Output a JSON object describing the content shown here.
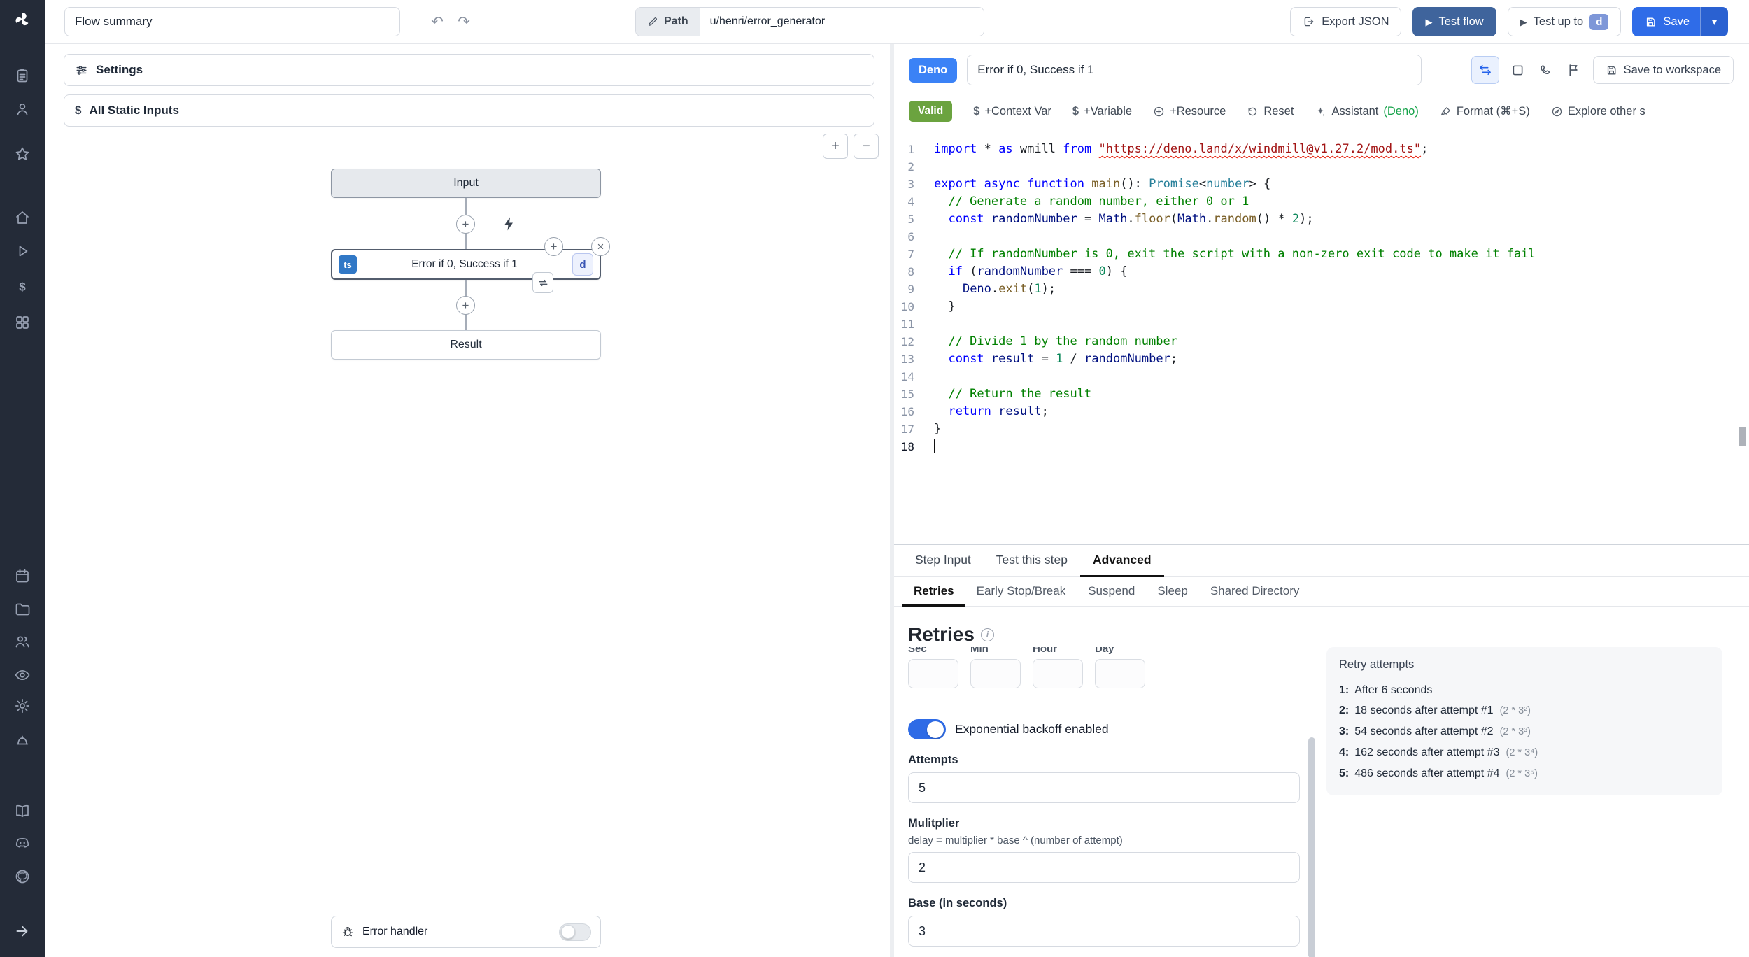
{
  "topbar": {
    "flow_summary": "Flow summary",
    "path_label": "Path",
    "path_value": "u/henri/error_generator",
    "export_json_label": "Export JSON",
    "test_flow_label": "Test flow",
    "test_up_to_label": "Test up to",
    "test_up_to_step": "d",
    "save_label": "Save"
  },
  "flow_panel": {
    "settings_label": "Settings",
    "static_inputs_label": "All Static Inputs",
    "zoom_in": "+",
    "zoom_out": "−",
    "input_node": "Input",
    "step_node": {
      "lang": "ts",
      "label": "Error if 0, Success if 1",
      "id": "d"
    },
    "result_node": "Result",
    "error_handler_label": "Error handler"
  },
  "editor": {
    "lang_badge": "Deno",
    "step_name": "Error if 0, Success if 1",
    "save_to_workspace_label": "Save to workspace",
    "toolbar": {
      "valid": "Valid",
      "context_var": "+Context Var",
      "variable": "+Variable",
      "resource": "+Resource",
      "reset": "Reset",
      "assistant": "Assistant",
      "assistant_lang": "(Deno)",
      "format": "Format (⌘+S)",
      "explore": "Explore other s"
    },
    "lines": [
      {
        "segs": [
          [
            "kw",
            "import"
          ],
          [
            "pl",
            " * "
          ],
          [
            "kw",
            "as"
          ],
          [
            "pl",
            " wmill "
          ],
          [
            "kw",
            "from"
          ],
          [
            "pl",
            " "
          ],
          [
            "stre",
            "\"https://deno.land/x/windmill@v1.27.2/mod.ts\""
          ],
          [
            "pl",
            ";"
          ]
        ]
      },
      {
        "segs": []
      },
      {
        "segs": [
          [
            "kw",
            "export"
          ],
          [
            "pl",
            " "
          ],
          [
            "kw",
            "async"
          ],
          [
            "pl",
            " "
          ],
          [
            "kw",
            "function"
          ],
          [
            "pl",
            " "
          ],
          [
            "fn",
            "main"
          ],
          [
            "pl",
            "(): "
          ],
          [
            "ty",
            "Promise"
          ],
          [
            "pl",
            "<"
          ],
          [
            "ty",
            "number"
          ],
          [
            "pl",
            "> {"
          ]
        ]
      },
      {
        "segs": [
          [
            "cm",
            "  // Generate a random number, either 0 or 1"
          ]
        ]
      },
      {
        "segs": [
          [
            "pl",
            "  "
          ],
          [
            "kw",
            "const"
          ],
          [
            "pl",
            " "
          ],
          [
            "vr",
            "randomNumber"
          ],
          [
            "pl",
            " = "
          ],
          [
            "vr",
            "Math"
          ],
          [
            "pl",
            "."
          ],
          [
            "fn",
            "floor"
          ],
          [
            "pl",
            "("
          ],
          [
            "vr",
            "Math"
          ],
          [
            "pl",
            "."
          ],
          [
            "fn",
            "random"
          ],
          [
            "pl",
            "() * "
          ],
          [
            "num",
            "2"
          ],
          [
            "pl",
            ");"
          ]
        ]
      },
      {
        "segs": []
      },
      {
        "segs": [
          [
            "cm",
            "  // If randomNumber is 0, exit the script with a non-zero exit code to make it fail"
          ]
        ]
      },
      {
        "segs": [
          [
            "pl",
            "  "
          ],
          [
            "kw",
            "if"
          ],
          [
            "pl",
            " ("
          ],
          [
            "vr",
            "randomNumber"
          ],
          [
            "pl",
            " === "
          ],
          [
            "num",
            "0"
          ],
          [
            "pl",
            ") {"
          ]
        ]
      },
      {
        "segs": [
          [
            "pl",
            "    "
          ],
          [
            "vr",
            "Deno"
          ],
          [
            "pl",
            "."
          ],
          [
            "fn",
            "exit"
          ],
          [
            "pl",
            "("
          ],
          [
            "num",
            "1"
          ],
          [
            "pl",
            ");"
          ]
        ]
      },
      {
        "segs": [
          [
            "pl",
            "  }"
          ]
        ]
      },
      {
        "segs": []
      },
      {
        "segs": [
          [
            "cm",
            "  // Divide 1 by the random number"
          ]
        ]
      },
      {
        "segs": [
          [
            "pl",
            "  "
          ],
          [
            "kw",
            "const"
          ],
          [
            "pl",
            " "
          ],
          [
            "vr",
            "result"
          ],
          [
            "pl",
            " = "
          ],
          [
            "num",
            "1"
          ],
          [
            "pl",
            " / "
          ],
          [
            "vr",
            "randomNumber"
          ],
          [
            "pl",
            ";"
          ]
        ]
      },
      {
        "segs": []
      },
      {
        "segs": [
          [
            "cm",
            "  // Return the result"
          ]
        ]
      },
      {
        "segs": [
          [
            "pl",
            "  "
          ],
          [
            "kw",
            "return"
          ],
          [
            "pl",
            " "
          ],
          [
            "vr",
            "result"
          ],
          [
            "pl",
            ";"
          ]
        ]
      },
      {
        "segs": [
          [
            "pl",
            "}"
          ]
        ]
      },
      {
        "segs": []
      }
    ]
  },
  "panel_tabs": {
    "step_input": "Step Input",
    "test_this_step": "Test this step",
    "advanced": "Advanced"
  },
  "advanced_tabs": {
    "retries": "Retries",
    "early_stop": "Early Stop/Break",
    "suspend": "Suspend",
    "sleep": "Sleep",
    "shared_directory": "Shared Directory"
  },
  "retries": {
    "title": "Retries",
    "time_labels": [
      "Sec",
      "Min",
      "Hour",
      "Day"
    ],
    "exponential_label": "Exponential backoff enabled",
    "attempts_label": "Attempts",
    "attempts_value": "5",
    "multiplier_label": "Mulitplier",
    "multiplier_help": "delay = multiplier * base ^ (number of attempt)",
    "multiplier_value": "2",
    "base_label": "Base (in seconds)",
    "base_value": "3"
  },
  "retry_attempts": {
    "title": "Retry attempts",
    "items": [
      {
        "n": "1:",
        "text": "After 6 seconds",
        "note": ""
      },
      {
        "n": "2:",
        "text": "18 seconds after attempt #1",
        "note": "(2 * 3²)"
      },
      {
        "n": "3:",
        "text": "54 seconds after attempt #2",
        "note": "(2 * 3³)"
      },
      {
        "n": "4:",
        "text": "162 seconds after attempt #3",
        "note": "(2 * 3⁴)"
      },
      {
        "n": "5:",
        "text": "486 seconds after attempt #4",
        "note": "(2 * 3⁵)"
      }
    ]
  },
  "sidebar_icons": [
    "windmill-logo",
    "clipboard",
    "user",
    "star",
    "home",
    "play",
    "dollar",
    "apps",
    "calendar",
    "folder",
    "users",
    "eye",
    "gear",
    "hard-hat",
    "book",
    "discord",
    "github",
    "collapse-arrow"
  ]
}
